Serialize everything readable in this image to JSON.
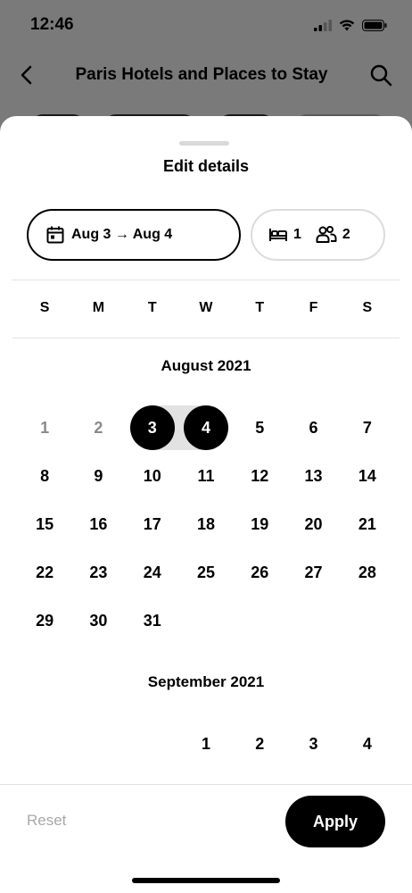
{
  "status_bar": {
    "time": "12:46"
  },
  "header": {
    "title": "Paris Hotels and Places to Stay"
  },
  "sheet": {
    "title": "Edit details",
    "dates_label": "Aug 3 → Aug 4",
    "rooms": "1",
    "guests": "2"
  },
  "weekdays": [
    "S",
    "M",
    "T",
    "W",
    "T",
    "F",
    "S"
  ],
  "august": {
    "title": "August 2021",
    "weeks": [
      [
        "1",
        "2",
        "3",
        "4",
        "5",
        "6",
        "7"
      ],
      [
        "8",
        "9",
        "10",
        "11",
        "12",
        "13",
        "14"
      ],
      [
        "15",
        "16",
        "17",
        "18",
        "19",
        "20",
        "21"
      ],
      [
        "22",
        "23",
        "24",
        "25",
        "26",
        "27",
        "28"
      ],
      [
        "29",
        "30",
        "31",
        "",
        "",
        "",
        ""
      ]
    ],
    "past_days": [
      "1",
      "2"
    ],
    "selected": [
      "3",
      "4"
    ]
  },
  "september": {
    "title": "September 2021",
    "weeks": [
      [
        "",
        "",
        "",
        "1",
        "2",
        "3",
        "4"
      ]
    ]
  },
  "footer": {
    "reset_label": "Reset",
    "apply_label": "Apply"
  },
  "colors": {
    "accent": "#000000",
    "range": "#e2e2e2",
    "muted": "#8a8a8a"
  }
}
